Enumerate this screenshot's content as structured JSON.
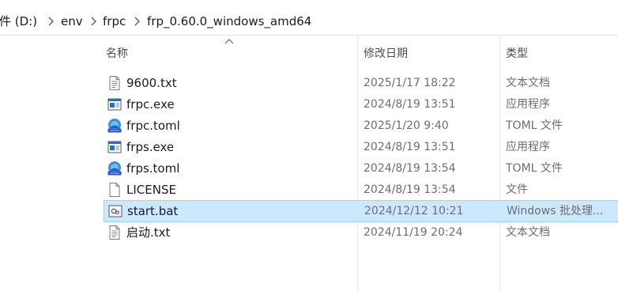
{
  "breadcrumb": [
    "文件 (D:)",
    "env",
    "frpc",
    "frp_0.60.0_windows_amd64"
  ],
  "columns": {
    "name": "名称",
    "modified": "修改日期",
    "type": "类型"
  },
  "files": [
    {
      "name": "9600.txt",
      "modified": "2025/1/17 18:22",
      "type": "文本文档",
      "icon": "text-file-icon"
    },
    {
      "name": "frpc.exe",
      "modified": "2024/8/19 13:51",
      "type": "应用程序",
      "icon": "exe-file-icon"
    },
    {
      "name": "frpc.toml",
      "modified": "2025/1/20 9:40",
      "type": "TOML 文件",
      "icon": "toml-file-icon"
    },
    {
      "name": "frps.exe",
      "modified": "2024/8/19 13:51",
      "type": "应用程序",
      "icon": "exe-file-icon"
    },
    {
      "name": "frps.toml",
      "modified": "2024/8/19 13:54",
      "type": "TOML 文件",
      "icon": "toml-file-icon"
    },
    {
      "name": "LICENSE",
      "modified": "2024/8/19 13:54",
      "type": "文件",
      "icon": "blank-file-icon"
    },
    {
      "name": "start.bat",
      "modified": "2024/12/12 10:21",
      "type": "Windows 批处理...",
      "icon": "bat-file-icon",
      "selected": true
    },
    {
      "name": "启动.txt",
      "modified": "2024/11/19 20:24",
      "type": "文本文档",
      "icon": "text-file-icon"
    }
  ],
  "colors": {
    "selection_bg": "#cce8ff",
    "selection_border": "#99d1ff",
    "exe_blue": "#1e6fd6",
    "toml_blue": "#3a8ee6"
  }
}
